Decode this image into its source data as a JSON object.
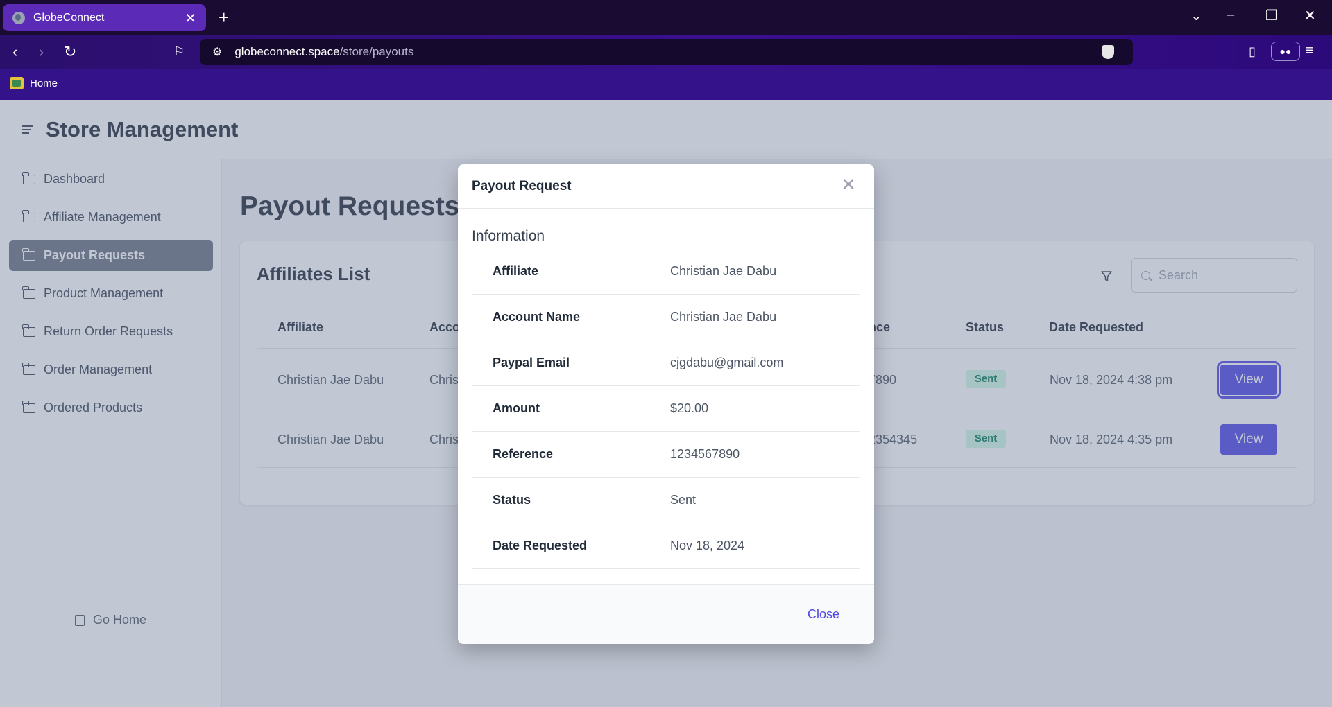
{
  "browser": {
    "tab_title": "GlobeConnect",
    "url_host": "globeconnect.space",
    "url_path": "/store/payouts",
    "bookmark_home": "Home"
  },
  "app": {
    "title": "Store Management",
    "sidebar": {
      "items": [
        {
          "label": "Dashboard"
        },
        {
          "label": "Affiliate Management"
        },
        {
          "label": "Payout Requests",
          "active": true
        },
        {
          "label": "Product Management"
        },
        {
          "label": "Return Order Requests"
        },
        {
          "label": "Order Management"
        },
        {
          "label": "Ordered Products"
        }
      ],
      "go_home": "Go Home"
    },
    "page_title": "Payout Requests",
    "list": {
      "title": "Affiliates List",
      "search_placeholder": "Search",
      "columns": [
        "Affiliate",
        "Acco",
        "nce",
        "Status",
        "Date Requested"
      ],
      "rows": [
        {
          "affiliate": "Christian Jae Dabu",
          "account": "Chris",
          "reference": "7890",
          "status": "Sent",
          "date": "Nov 18, 2024 4:38 pm",
          "action": "View"
        },
        {
          "affiliate": "Christian Jae Dabu",
          "account": "Chris",
          "reference": "2354345",
          "status": "Sent",
          "date": "Nov 18, 2024 4:35 pm",
          "action": "View"
        }
      ]
    }
  },
  "modal": {
    "title": "Payout Request",
    "section": "Information",
    "fields": [
      {
        "label": "Affiliate",
        "value": "Christian Jae Dabu"
      },
      {
        "label": "Account Name",
        "value": "Christian Jae Dabu"
      },
      {
        "label": "Paypal Email",
        "value": "cjgdabu@gmail.com"
      },
      {
        "label": "Amount",
        "value": "$20.00"
      },
      {
        "label": "Reference",
        "value": "1234567890"
      },
      {
        "label": "Status",
        "value": "Sent"
      },
      {
        "label": "Date Requested",
        "value": "Nov 18, 2024"
      }
    ],
    "close_label": "Close"
  }
}
